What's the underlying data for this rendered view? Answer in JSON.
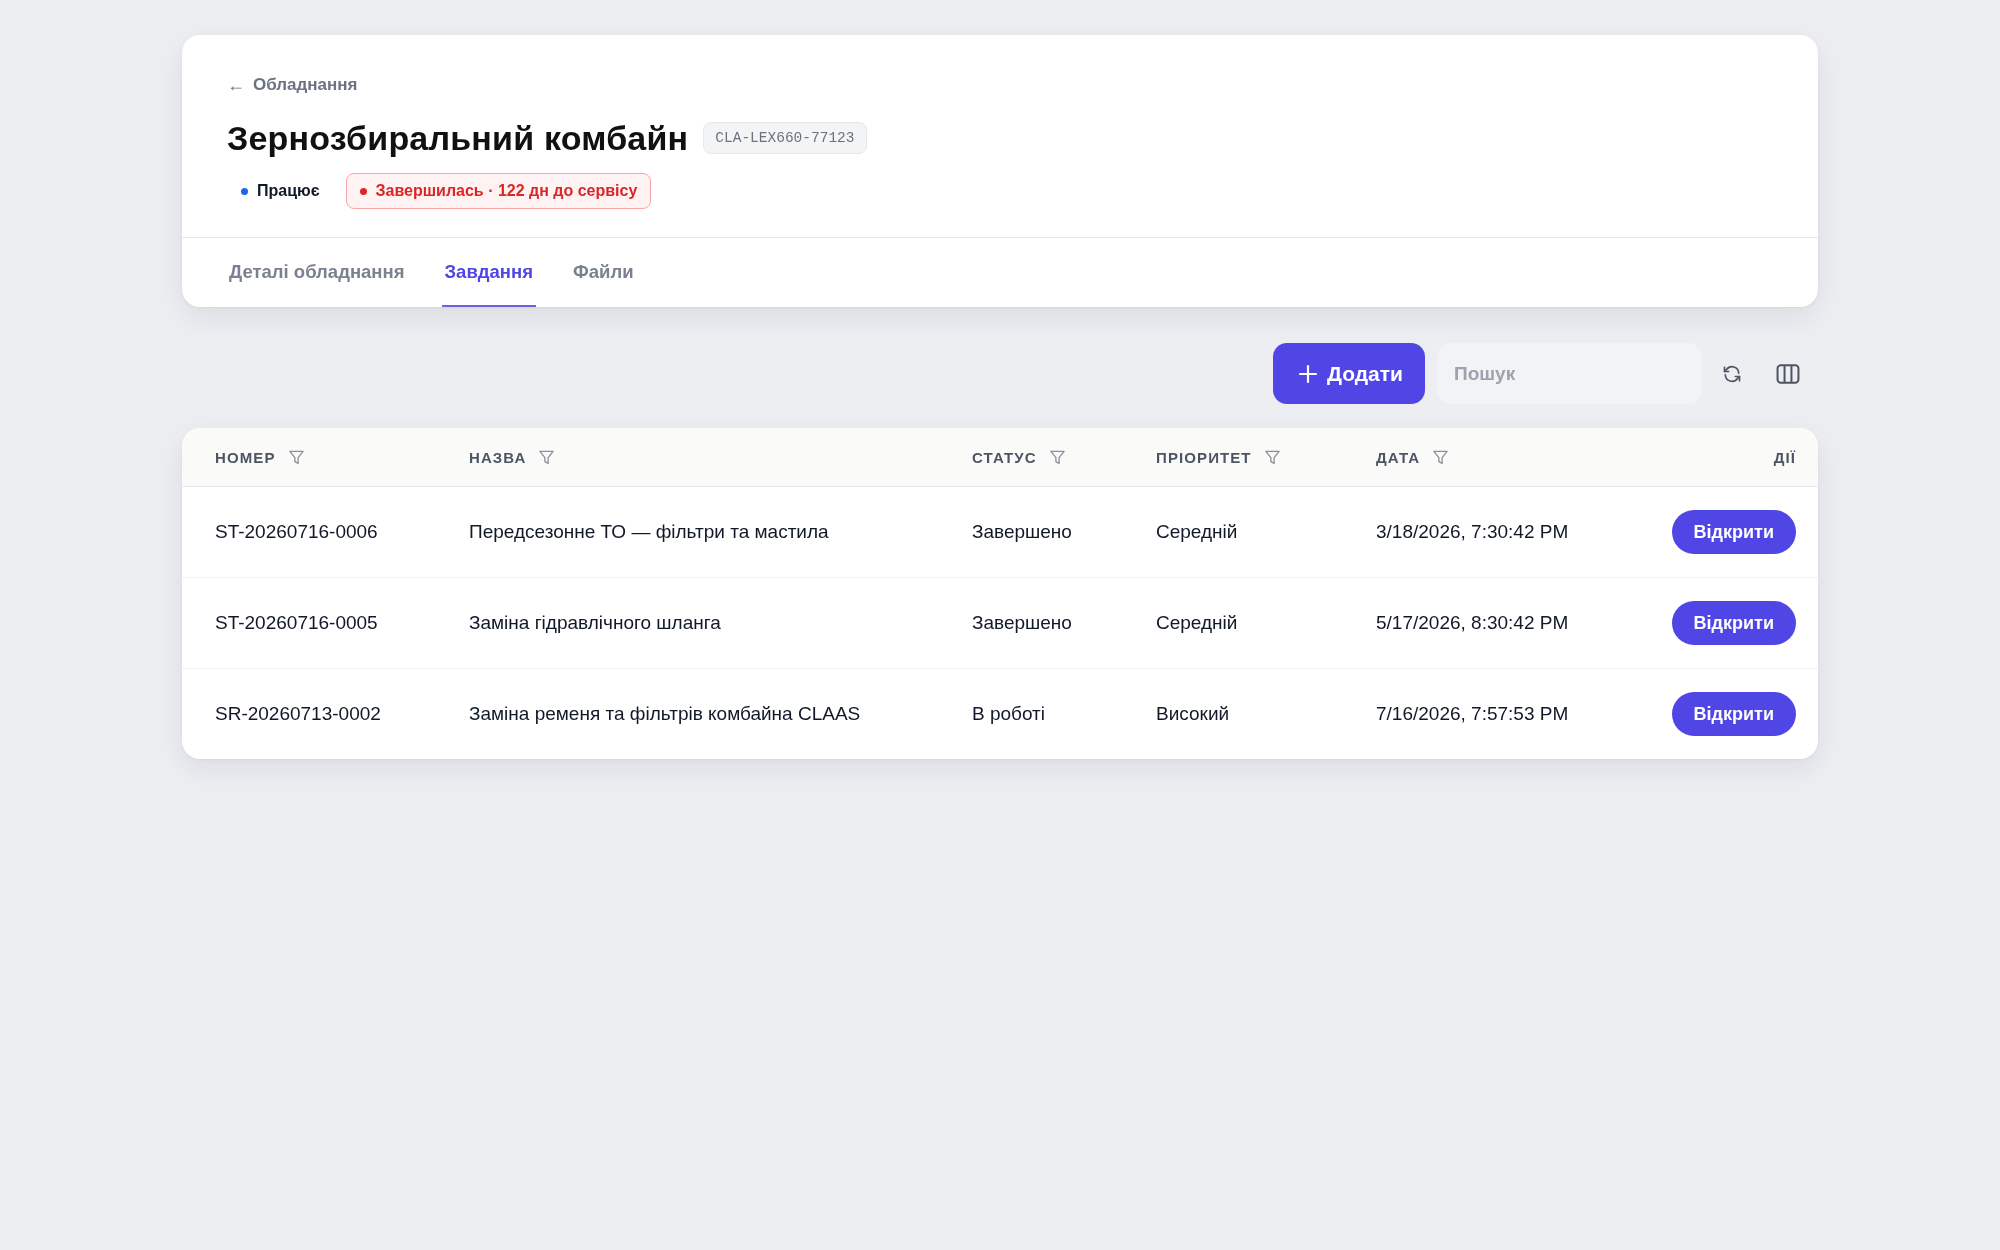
{
  "header": {
    "back_link": {
      "arrow": "←",
      "label": "Обладнання"
    },
    "title": "Зернозбиральний комбайн",
    "code": "CLA-LEX660-77123",
    "badges": [
      {
        "kind": "plain",
        "label": "Працює",
        "color": "#2563eb"
      },
      {
        "kind": "alert",
        "label": "Завершилась · 122 дн до сервісу",
        "color": "#dc2626"
      }
    ]
  },
  "tabs": [
    {
      "label": "Деталі обладнання",
      "selected": false
    },
    {
      "label": "Завдання",
      "selected": true
    },
    {
      "label": "Файли",
      "selected": false
    }
  ],
  "toolbar": {
    "add_button": "Додати",
    "search": {
      "placeholder": "Пошук"
    }
  },
  "table": {
    "columns": [
      {
        "label": "НОМЕР",
        "filter": true
      },
      {
        "label": "НАЗВА",
        "filter": true
      },
      {
        "label": "СТАТУС",
        "filter": true
      },
      {
        "label": "ПРІОРИТЕТ",
        "filter": true
      },
      {
        "label": "ДАТА",
        "filter": true
      },
      {
        "label": "ДІЇ",
        "filter": false
      }
    ],
    "rows": [
      {
        "cells": [
          "ST-20260716-0006",
          "Передсезонне ТО — фільтри та мастила",
          "Завершено",
          "Середній",
          "3/18/2026, 7:30:42 PM"
        ],
        "action": "Відкрити"
      },
      {
        "cells": [
          "ST-20260716-0005",
          "Заміна гідравлічного шланга",
          "Завершено",
          "Середній",
          "5/17/2026, 8:30:42 PM"
        ],
        "action": "Відкрити"
      },
      {
        "cells": [
          "SR-20260713-0002",
          "Заміна ременя та фільтрів комбайна CLAAS",
          "В роботі",
          "Високий",
          "7/16/2026, 7:57:53 PM"
        ],
        "action": "Відкрити"
      }
    ]
  }
}
